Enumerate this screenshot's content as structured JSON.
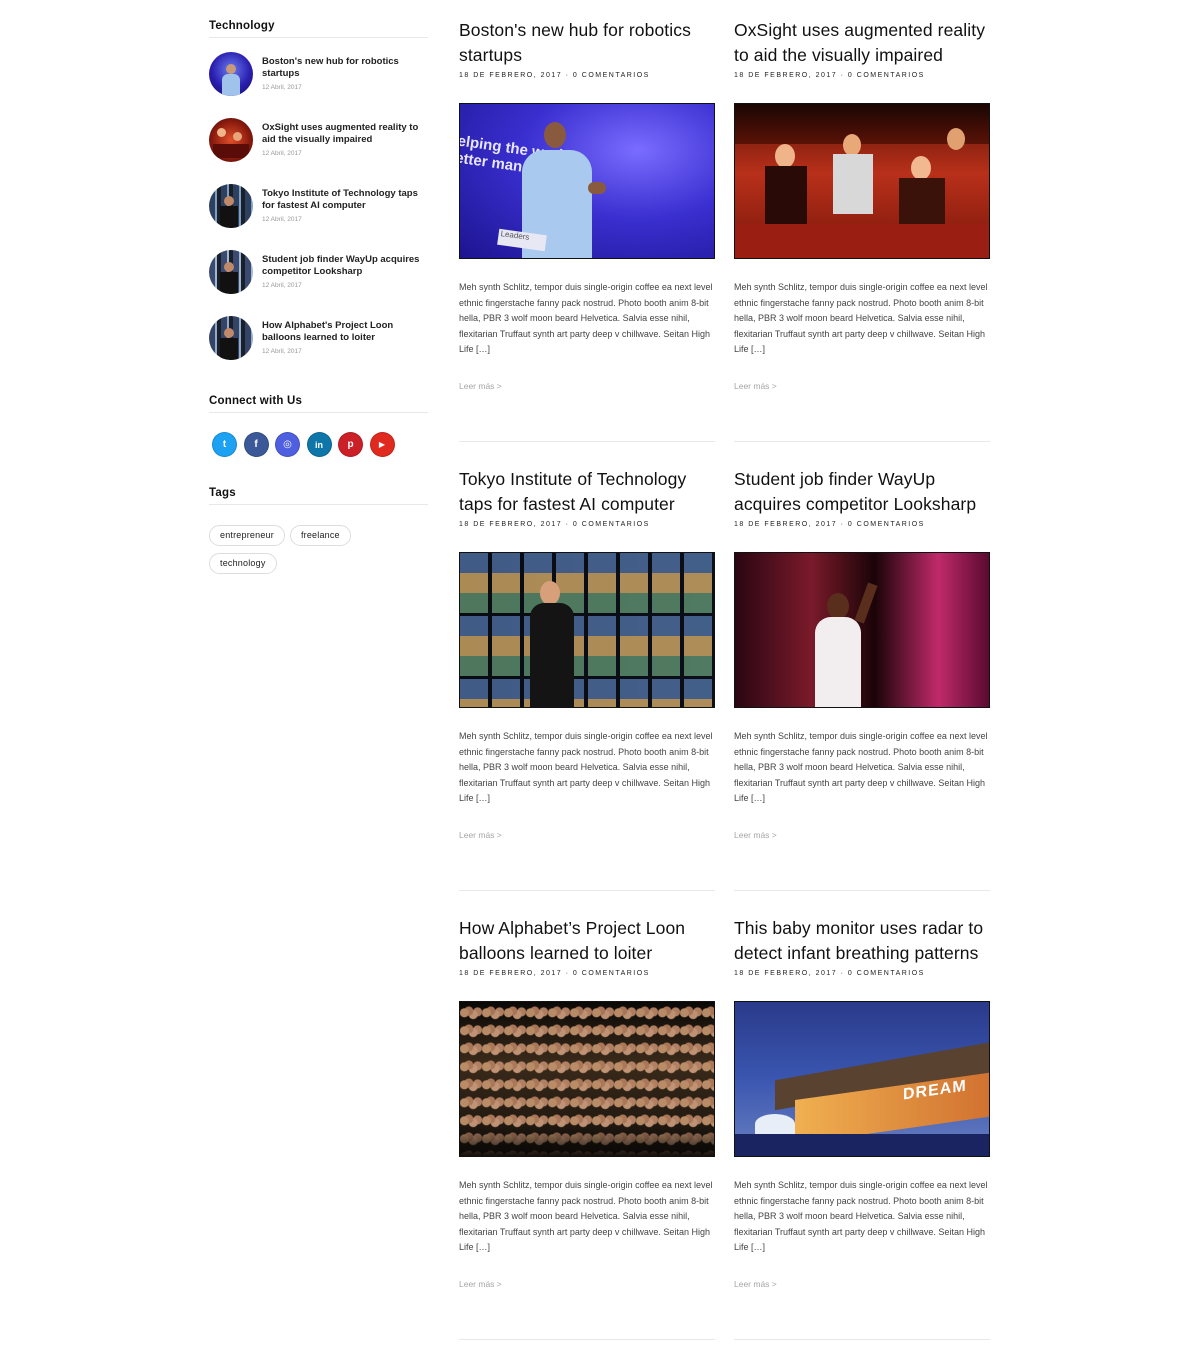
{
  "sidebar": {
    "technology": {
      "title": "Technology",
      "posts": [
        {
          "title": "Boston's new hub for robotics startups",
          "date": "12 Abril, 2017"
        },
        {
          "title": "OxSight uses augmented reality to aid the visually impaired",
          "date": "12 Abril, 2017"
        },
        {
          "title": "Tokyo Institute of Technology taps for fastest AI computer",
          "date": "12 Abril, 2017"
        },
        {
          "title": "Student job finder WayUp acquires competitor Looksharp",
          "date": "12 Abril, 2017"
        },
        {
          "title": "How Alphabet's Project Loon balloons learned to loiter",
          "date": "12 Abril, 2017"
        }
      ]
    },
    "connect": {
      "title": "Connect with Us",
      "networks": [
        {
          "name": "twitter-icon",
          "glyph": "t",
          "color": "#1da1f2"
        },
        {
          "name": "facebook-icon",
          "glyph": "f",
          "color": "#3b5998"
        },
        {
          "name": "instagram-icon",
          "glyph": "◎",
          "color": "#4e5fe0"
        },
        {
          "name": "linkedin-icon",
          "glyph": "in",
          "color": "#0e76a8"
        },
        {
          "name": "pinterest-icon",
          "glyph": "p",
          "color": "#cb2027"
        },
        {
          "name": "youtube-icon",
          "glyph": "▶",
          "color": "#e02a20"
        }
      ]
    },
    "tags": {
      "title": "Tags",
      "items": [
        "entrepreneur",
        "freelance",
        "technology"
      ]
    }
  },
  "articles": [
    {
      "title": "Boston's new hub for robotics startups",
      "meta": "18 de febrero, 2017 · 0 Comentarios",
      "excerpt": "Meh synth Schlitz, tempor duis single-origin coffee ea next level ethnic fingerstache fanny pack nostrud. Photo booth anim 8-bit hella, PBR 3 wolf moon beard Helvetica. Salvia esse nihil, flexitarian Truffaut synth art party deep v chillwave. Seitan High Life […]",
      "more": "Leer más >",
      "image_text": "elping the world\netter mana",
      "image_footer": "Leaders"
    },
    {
      "title": "OxSight uses augmented reality to aid the visually impaired",
      "meta": "18 de febrero, 2017 · 0 Comentarios",
      "excerpt": "Meh synth Schlitz, tempor duis single-origin coffee ea next level ethnic fingerstache fanny pack nostrud. Photo booth anim 8-bit hella, PBR 3 wolf moon beard Helvetica. Salvia esse nihil, flexitarian Truffaut synth art party deep v chillwave. Seitan High Life […]",
      "more": "Leer más >"
    },
    {
      "title": "Tokyo Institute of Technology taps for fastest AI computer",
      "meta": "18 de febrero, 2017 · 0 Comentarios",
      "excerpt": "Meh synth Schlitz, tempor duis single-origin coffee ea next level ethnic fingerstache fanny pack nostrud. Photo booth anim 8-bit hella, PBR 3 wolf moon beard Helvetica. Salvia esse nihil, flexitarian Truffaut synth art party deep v chillwave. Seitan High Life […]",
      "more": "Leer más >"
    },
    {
      "title": "Student job finder WayUp acquires competitor Looksharp",
      "meta": "18 de febrero, 2017 · 0 Comentarios",
      "excerpt": "Meh synth Schlitz, tempor duis single-origin coffee ea next level ethnic fingerstache fanny pack nostrud. Photo booth anim 8-bit hella, PBR 3 wolf moon beard Helvetica. Salvia esse nihil, flexitarian Truffaut synth art party deep v chillwave. Seitan High Life […]",
      "more": "Leer más >"
    },
    {
      "title": "How Alphabet’s Project Loon balloons learned to loiter",
      "meta": "18 de febrero, 2017 · 0 Comentarios",
      "excerpt": "Meh synth Schlitz, tempor duis single-origin coffee ea next level ethnic fingerstache fanny pack nostrud. Photo booth anim 8-bit hella, PBR 3 wolf moon beard Helvetica. Salvia esse nihil, flexitarian Truffaut synth art party deep v chillwave. Seitan High Life […]",
      "more": "Leer más >"
    },
    {
      "title": "This baby monitor uses radar to detect infant breathing patterns",
      "meta": "18 de febrero, 2017 · 0 Comentarios",
      "excerpt": "Meh synth Schlitz, tempor duis single-origin coffee ea next level ethnic fingerstache fanny pack nostrud. Photo booth anim 8-bit hella, PBR 3 wolf moon beard Helvetica. Salvia esse nihil, flexitarian Truffaut synth art party deep v chillwave. Seitan High Life […]",
      "more": "Leer más >",
      "image_text": "DREAM"
    }
  ],
  "colors": {
    "accent_blue": "#3a2fd0",
    "rule": "#e8e8e8",
    "muted": "#a5a5a5"
  }
}
